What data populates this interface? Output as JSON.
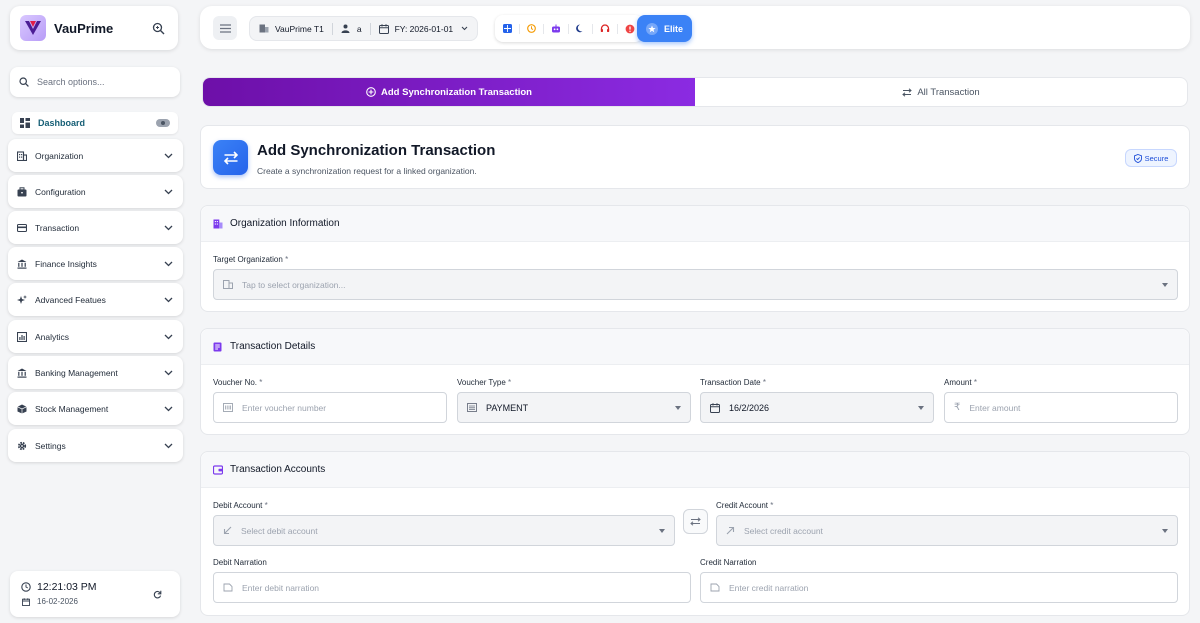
{
  "brand": {
    "name": "VauPrime"
  },
  "sidebar": {
    "search_placeholder": "Search options...",
    "dashboard": "Dashboard",
    "items": [
      {
        "label": "Organization"
      },
      {
        "label": "Configuration"
      },
      {
        "label": "Transaction"
      },
      {
        "label": "Finance Insights"
      },
      {
        "label": "Advanced Featues"
      },
      {
        "label": "Analytics"
      },
      {
        "label": "Banking Management"
      },
      {
        "label": "Stock Management"
      },
      {
        "label": "Settings"
      }
    ],
    "clock": {
      "time": "12:21:03 PM",
      "date": "16-02-2026"
    }
  },
  "topbar": {
    "organization": "VauPrime T1",
    "user": "a",
    "fiscal_year": "FY: 2026-01-01",
    "plan_button": "Elite",
    "quick_icons": [
      "grid-icon",
      "clock-icon",
      "robot-icon",
      "moon-icon",
      "headset-icon",
      "alert-icon"
    ]
  },
  "tabs": {
    "add": "Add Synchronization Transaction",
    "all": "All Transaction"
  },
  "header": {
    "title": "Add Synchronization Transaction",
    "subtitle": "Create a synchronization request for a linked organization.",
    "badge": "Secure"
  },
  "org_section": {
    "title": "Organization Information",
    "target_label": "Target Organization",
    "target_placeholder": "Tap to select organization..."
  },
  "details_section": {
    "title": "Transaction Details",
    "voucher_no_label": "Voucher No.",
    "voucher_no_placeholder": "Enter voucher number",
    "voucher_type_label": "Voucher Type",
    "voucher_type_value": "PAYMENT",
    "date_label": "Transaction Date",
    "date_value": "16/2/2026",
    "amount_label": "Amount",
    "amount_placeholder": "Enter amount"
  },
  "accounts_section": {
    "title": "Transaction Accounts",
    "debit_label": "Debit Account",
    "debit_placeholder": "Select debit account",
    "credit_label": "Credit Account",
    "credit_placeholder": "Select credit account",
    "debit_narration_label": "Debit Narration",
    "debit_narration_placeholder": "Enter debit narration",
    "credit_narration_label": "Credit Narration",
    "credit_narration_placeholder": "Enter credit narration"
  },
  "required_mark": "*",
  "colors": {
    "accent_purple": "#7c1fd0",
    "accent_blue": "#3b82f6",
    "brand_teal": "#155e75"
  }
}
